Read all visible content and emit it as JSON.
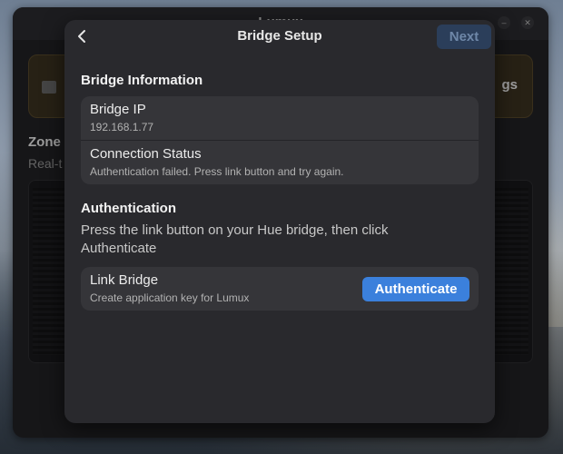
{
  "main_window": {
    "title": "Lumux",
    "alert_trailing_text": "gs",
    "zone_title": "Zone",
    "zone_subtitle": "Real-t"
  },
  "dialog": {
    "title": "Bridge Setup",
    "back_icon": "chevron-left-icon",
    "next_label": "Next",
    "sections": {
      "bridge_info": {
        "title": "Bridge Information",
        "rows": [
          {
            "title": "Bridge IP",
            "subtitle": "192.168.1.77"
          },
          {
            "title": "Connection Status",
            "subtitle": "Authentication failed. Press link button and try again."
          }
        ]
      },
      "authentication": {
        "title": "Authentication",
        "description": "Press the link button on your Hue bridge, then click Authenticate",
        "link_row": {
          "title": "Link Bridge",
          "subtitle": "Create application key for Lumux",
          "button_label": "Authenticate"
        }
      }
    }
  },
  "colors": {
    "accent": "#3b80dc",
    "dialog_bg": "#29292d",
    "row_bg": "#353539",
    "next_disabled": "#2b3e5a",
    "alert_bg": "#3d3321"
  }
}
